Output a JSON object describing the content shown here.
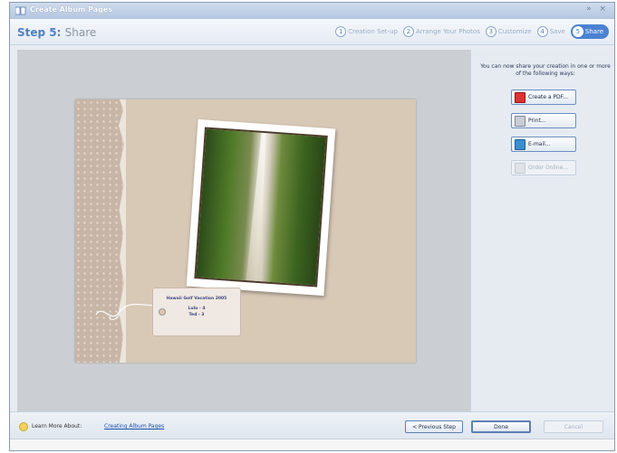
{
  "window": {
    "title": "Create Album Pages",
    "controls": "» ×"
  },
  "step": {
    "number": "Step 5:",
    "name": "Share"
  },
  "wizard_steps": [
    {
      "num": "1",
      "label": "Creation Set-up"
    },
    {
      "num": "2",
      "label": "Arrange Your Photos"
    },
    {
      "num": "3",
      "label": "Customize"
    },
    {
      "num": "4",
      "label": "Save"
    },
    {
      "num": "5",
      "label": "Share"
    }
  ],
  "tag": {
    "title": "Hawaii Golf Vacation 2005",
    "line1": "Lulu - 4",
    "line2": "Ted - 3"
  },
  "share_panel": {
    "intro": "You can now share your creation in one or more of the following ways:",
    "buttons": [
      "Create a PDF...",
      "Print...",
      "E-mail...",
      "Order Online..."
    ]
  },
  "footer": {
    "learn_more": "Learn More About:",
    "link": "Creating Album Pages",
    "previous": "< Previous Step",
    "done": "Done",
    "cancel": "Cancel"
  },
  "colors": {
    "accent": "#4a82d2",
    "step_number": "#4f80c4"
  }
}
